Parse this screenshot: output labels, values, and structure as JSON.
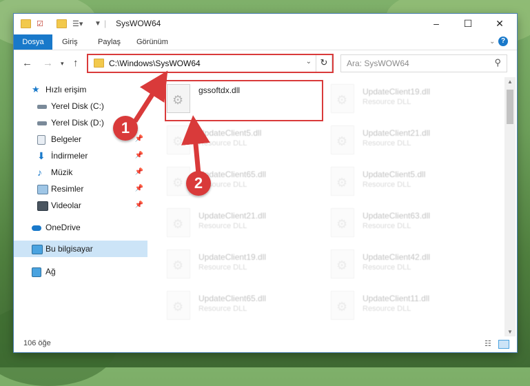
{
  "window": {
    "title": "SysWOW64",
    "minimize": "–",
    "maximize": "☐",
    "close": "✕"
  },
  "ribbon": {
    "tabs": [
      "Dosya",
      "Giriş",
      "Paylaş",
      "Görünüm"
    ]
  },
  "address": {
    "path": "C:\\Windows\\SysWOW64",
    "search_placeholder": "Ara: SysWOW64"
  },
  "sidebar": {
    "items": [
      {
        "label": "Hızlı erişim",
        "icon": "star-icon",
        "pinned": false
      },
      {
        "label": "Yerel Disk (C:)",
        "icon": "drive-icon",
        "pinned": false
      },
      {
        "label": "Yerel Disk (D:)",
        "icon": "drive-icon",
        "pinned": false
      },
      {
        "label": "Belgeler",
        "icon": "documents-icon",
        "pinned": true
      },
      {
        "label": "İndirmeler",
        "icon": "download-icon",
        "pinned": true
      },
      {
        "label": "Müzik",
        "icon": "music-icon",
        "pinned": true
      },
      {
        "label": "Resimler",
        "icon": "pictures-icon",
        "pinned": true
      },
      {
        "label": "Videolar",
        "icon": "videos-icon",
        "pinned": true
      },
      {
        "label": "OneDrive",
        "icon": "cloud-icon",
        "pinned": false
      },
      {
        "label": "Bu bilgisayar",
        "icon": "computer-icon",
        "pinned": false,
        "selected": true
      },
      {
        "label": "Ağ",
        "icon": "network-icon",
        "pinned": false
      }
    ]
  },
  "files": {
    "primary": {
      "name": "gssoftdx.dll"
    },
    "left_column": [
      {
        "name": "UpdateClient5.dll",
        "type": "Resource DLL"
      },
      {
        "name": "UpdateClient65.dll",
        "type": "Resource DLL"
      },
      {
        "name": "UpdateClient21.dll",
        "type": "Resource DLL"
      },
      {
        "name": "UpdateClient19.dll",
        "type": "Resource DLL"
      },
      {
        "name": "UpdateClient65.dll",
        "type": "Resource DLL"
      }
    ],
    "right_column": [
      {
        "name": "UpdateClient19.dll",
        "type": "Resource DLL"
      },
      {
        "name": "UpdateClient21.dll",
        "type": "Resource DLL"
      },
      {
        "name": "UpdateClient5.dll",
        "type": "Resource DLL"
      },
      {
        "name": "UpdateClient63.dll",
        "type": "Resource DLL"
      },
      {
        "name": "UpdateClient42.dll",
        "type": "Resource DLL"
      },
      {
        "name": "UpdateClient11.dll",
        "type": "Resource DLL"
      }
    ]
  },
  "status": {
    "item_count": "106 öğe"
  },
  "callouts": [
    "1",
    "2"
  ],
  "colors": {
    "accent": "#1979ca",
    "highlight": "#d93a3a",
    "selected_bg": "#cce4f7"
  }
}
